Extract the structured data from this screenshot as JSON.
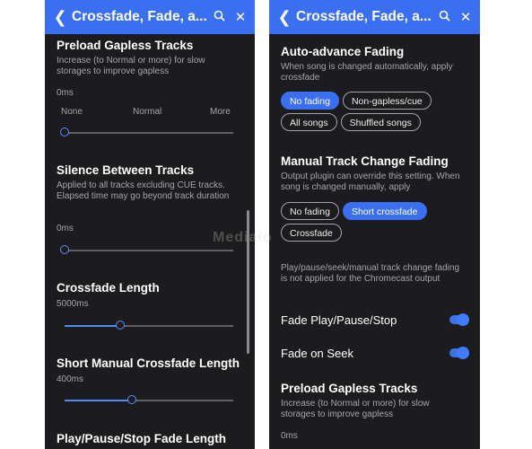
{
  "left": {
    "header": {
      "title": "Crossfade, Fade, a...",
      "back_icon": "back-arrow-icon",
      "search_icon": "search-icon",
      "close_icon": "close-icon"
    },
    "preload": {
      "title": "Preload Gapless Tracks",
      "description": "Increase (to Normal or more) for slow storages to improve gapless",
      "value": "0ms",
      "scale": [
        "None",
        "Normal",
        "More"
      ],
      "level": 0
    },
    "silence": {
      "title": "Silence Between Tracks",
      "description": "Applied to all tracks excluding CUE tracks. Elapsed time may go beyond track duration",
      "value": "0ms",
      "level": 0
    },
    "crossfade": {
      "title": "Crossfade Length",
      "value": "5000ms",
      "level": 0.33
    },
    "short_crossfade": {
      "title": "Short Manual Crossfade Length",
      "value": "400ms",
      "level": 0.4
    },
    "pause_fade": {
      "title": "Play/Pause/Stop Fade Length"
    }
  },
  "right": {
    "header": {
      "title": "Crossfade, Fade, a...",
      "back_icon": "back-arrow-icon",
      "search_icon": "search-icon",
      "close_icon": "close-icon"
    },
    "auto_advance": {
      "title": "Auto-advance Fading",
      "description": "When song is changed automatically, apply crossfade",
      "options": [
        "No fading",
        "Non-gapless/cue",
        "All songs",
        "Shuffled songs"
      ],
      "selected": "No fading"
    },
    "manual_change": {
      "title": "Manual Track Change Fading",
      "description": "Output plugin can override this setting. When song is changed manually, apply",
      "options": [
        "No fading",
        "Short crossfade",
        "Crossfade"
      ],
      "selected": "Short crossfade"
    },
    "chromecast_note": "Play/pause/seek/manual track change fading is not applied for the Chromecast output",
    "fade_pps": {
      "label": "Fade Play/Pause/Stop",
      "enabled": true
    },
    "fade_seek": {
      "label": "Fade on Seek",
      "enabled": true
    },
    "preload": {
      "title": "Preload Gapless Tracks",
      "description": "Increase (to Normal or more) for slow storages to improve gapless",
      "value": "0ms"
    }
  },
  "watermark": "Mediaio",
  "colors": {
    "accent": "#3a6ff2",
    "background": "#1c1c1e",
    "text": "#ffffff",
    "muted": "#a5a5aa"
  }
}
